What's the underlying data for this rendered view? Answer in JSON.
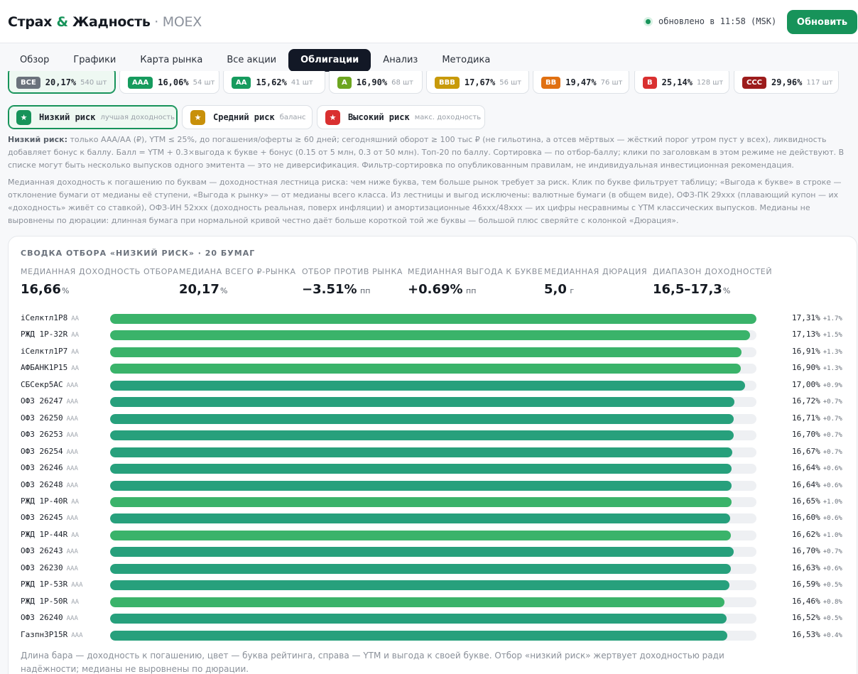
{
  "header": {
    "brand_a": "Страх ",
    "brand_amp": "&",
    "brand_b": " Жадность",
    "brand_exchange": " · MOEX",
    "update_text": "обновлено в 11:58 (MSK)",
    "refresh_label": "Обновить"
  },
  "tabs": [
    "Обзор",
    "Графики",
    "Карта рынка",
    "Все акции",
    "Облигации",
    "Анализ",
    "Методика"
  ],
  "active_tab": "Облигации",
  "ratings": [
    {
      "grade": "ВСЕ",
      "yield": "20,17%",
      "count": "540 шт",
      "color": "#6b727c",
      "selected": true
    },
    {
      "grade": "AAA",
      "yield": "16,06%",
      "count": "54 шт",
      "color": "#169b5e",
      "selected": false
    },
    {
      "grade": "AA",
      "yield": "15,62%",
      "count": "41 шт",
      "color": "#169b5e",
      "selected": false
    },
    {
      "grade": "A",
      "yield": "16,90%",
      "count": "68 шт",
      "color": "#6da520",
      "selected": false
    },
    {
      "grade": "BBB",
      "yield": "17,67%",
      "count": "56 шт",
      "color": "#c89a0a",
      "selected": false
    },
    {
      "grade": "BB",
      "yield": "19,47%",
      "count": "76 шт",
      "color": "#e07012",
      "selected": false
    },
    {
      "grade": "B",
      "yield": "25,14%",
      "count": "128 шт",
      "color": "#d93030",
      "selected": false
    },
    {
      "grade": "CCC",
      "yield": "29,96%",
      "count": "117 шт",
      "color": "#9c1c1c",
      "selected": false
    }
  ],
  "modes": [
    {
      "name": "Низкий риск",
      "sub": "лучшая доходность",
      "color": "#17935a",
      "selected": true
    },
    {
      "name": "Средний риск",
      "sub": "баланс",
      "color": "#c8900a",
      "selected": false
    },
    {
      "name": "Высокий риск",
      "sub": "макс. доходность",
      "color": "#d93030",
      "selected": false
    }
  ],
  "notes": {
    "low_risk_title": "Низкий риск:",
    "low_risk_text": " только AAA/AA (₽), YTM ≤ 25%, до погашения/оферты ≥ 60 дней; сегодняшний оборот ≥ 100 тыс ₽ (не гильотина, а отсев мёртвых — жёсткий порог утром пуст у всех), ликвидность добавляет бонус к баллу. Балл = YTM + 0.3×выгода к букве + бонус (0.15 от 5 млн, 0.3 от 50 млн). Топ-20 по баллу. Сортировка — по отбор-баллу; клики по заголовкам в этом режиме не действуют. В списке могут быть несколько выпусков одного эмитента — это не диверсификация. Фильтр-сортировка по опубликованным правилам, не индивидуальная инвестиционная рекомендация.",
    "median_text": "Медианная доходность к погашению по буквам — доходностная лестница риска: чем ниже буква, тем больше рынок требует за риск. Клик по букве фильтрует таблицу; «Выгода к букве» в строке — отклонение бумаги от медианы её ступени, «Выгода к рынку» — от медианы всего класса. Из лестницы и выгод исключены: валютные бумаги (в общем виде), ОФЗ-ПК 29ххх (плавающий купон — их «доходность» живёт со ставкой), ОФЗ-ИН 52ххх (доходность реальная, поверх инфляции) и амортизационные 46ххх/48ххх — их цифры несравнимы с YTM классических выпусков. Медианы не выровнены по дюрации: длинная бумага при нормальной кривой честно даёт больше короткой той же буквы — большой плюс сверяйте с колонкой «Дюрация»."
  },
  "summary": {
    "title": "СВОДКА ОТБОРА «НИЗКИЙ РИСК» · 20 БУМАГ",
    "metrics": [
      {
        "label": "МЕДИАННАЯ ДОХОДНОСТЬ ОТБОРА",
        "value": "16,66",
        "unit": "%"
      },
      {
        "label": "МЕДИАНА ВСЕГО ₽-РЫНКА",
        "value": "20,17",
        "unit": "%"
      },
      {
        "label": "ОТБОР ПРОТИВ РЫНКА",
        "value": "−3.51%",
        "unit": " пп"
      },
      {
        "label": "МЕДИАННАЯ ВЫГОДА К БУКВЕ",
        "value": "+0.69%",
        "unit": " пп"
      },
      {
        "label": "МЕДИАННАЯ ДЮРАЦИЯ",
        "value": "5,0",
        "unit": " г"
      },
      {
        "label": "ДИАПАЗОН ДОХОДНОСТЕЙ",
        "value": "16,5–17,3",
        "unit": "%"
      }
    ],
    "footnote": "Длина бара — доходность к погашению, цвет — буква рейтинга, справа — YTM и выгода к своей букве. Отбор «низкий риск» жертвует доходностью ради надёжности; медианы не выровнены по дюрации."
  },
  "chart_data": {
    "type": "bar",
    "orientation": "horizontal",
    "colors": {
      "AA": "#3ab36a",
      "AAA": "#27a07c"
    },
    "bonds": [
      {
        "name": "iСелктл1Р8",
        "rating": "AA",
        "ytm": 17.31,
        "ytm_label": "17,31%",
        "delta": "+1.7%"
      },
      {
        "name": "РЖД 1Р-32R",
        "rating": "AA",
        "ytm": 17.13,
        "ytm_label": "17,13%",
        "delta": "+1.5%"
      },
      {
        "name": "iСелктл1Р7",
        "rating": "AA",
        "ytm": 16.91,
        "ytm_label": "16,91%",
        "delta": "+1.3%"
      },
      {
        "name": "АФБАНК1Р15",
        "rating": "AA",
        "ytm": 16.9,
        "ytm_label": "16,90%",
        "delta": "+1.3%"
      },
      {
        "name": "СБСекр5АС",
        "rating": "AAA",
        "ytm": 17.0,
        "ytm_label": "17,00%",
        "delta": "+0.9%"
      },
      {
        "name": "ОФЗ 26247",
        "rating": "AAA",
        "ytm": 16.72,
        "ytm_label": "16,72%",
        "delta": "+0.7%"
      },
      {
        "name": "ОФЗ 26250",
        "rating": "AAA",
        "ytm": 16.71,
        "ytm_label": "16,71%",
        "delta": "+0.7%"
      },
      {
        "name": "ОФЗ 26253",
        "rating": "AAA",
        "ytm": 16.7,
        "ytm_label": "16,70%",
        "delta": "+0.7%"
      },
      {
        "name": "ОФЗ 26254",
        "rating": "AAA",
        "ytm": 16.67,
        "ytm_label": "16,67%",
        "delta": "+0.7%"
      },
      {
        "name": "ОФЗ 26246",
        "rating": "AAA",
        "ytm": 16.64,
        "ytm_label": "16,64%",
        "delta": "+0.6%"
      },
      {
        "name": "ОФЗ 26248",
        "rating": "AAA",
        "ytm": 16.64,
        "ytm_label": "16,64%",
        "delta": "+0.6%"
      },
      {
        "name": "РЖД 1Р-40R",
        "rating": "AA",
        "ytm": 16.65,
        "ytm_label": "16,65%",
        "delta": "+1.0%"
      },
      {
        "name": "ОФЗ 26245",
        "rating": "AAA",
        "ytm": 16.6,
        "ytm_label": "16,60%",
        "delta": "+0.6%"
      },
      {
        "name": "РЖД 1Р-44R",
        "rating": "AA",
        "ytm": 16.62,
        "ytm_label": "16,62%",
        "delta": "+1.0%"
      },
      {
        "name": "ОФЗ 26243",
        "rating": "AAA",
        "ytm": 16.7,
        "ytm_label": "16,70%",
        "delta": "+0.7%"
      },
      {
        "name": "ОФЗ 26230",
        "rating": "AAA",
        "ytm": 16.63,
        "ytm_label": "16,63%",
        "delta": "+0.6%"
      },
      {
        "name": "РЖД 1Р-53R",
        "rating": "AAA",
        "ytm": 16.59,
        "ytm_label": "16,59%",
        "delta": "+0.5%"
      },
      {
        "name": "РЖД 1Р-50R",
        "rating": "AA",
        "ytm": 16.46,
        "ytm_label": "16,46%",
        "delta": "+0.8%"
      },
      {
        "name": "ОФЗ 26240",
        "rating": "AAA",
        "ytm": 16.52,
        "ytm_label": "16,52%",
        "delta": "+0.5%"
      },
      {
        "name": "ГазпнЗР15R",
        "rating": "AAA",
        "ytm": 16.53,
        "ytm_label": "16,53%",
        "delta": "+0.4%"
      }
    ]
  }
}
